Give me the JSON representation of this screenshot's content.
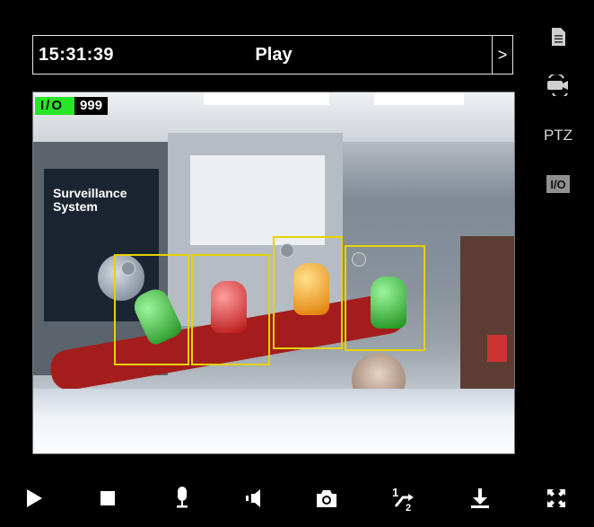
{
  "topbar": {
    "time": "15:31:39",
    "mode": "Play",
    "next_glyph": ">"
  },
  "overlay": {
    "io_label": "I/O",
    "io_count": "999"
  },
  "poster": {
    "title_line1": "Surveillance",
    "title_line2": "System"
  },
  "side_panel": {
    "ptz_label": "PTZ",
    "io_button_label": "I/O"
  },
  "icons": {
    "document": "document-icon",
    "camera_switch": "camera-switch-icon",
    "play": "play-icon",
    "stop": "stop-icon",
    "microphone": "microphone-icon",
    "speaker": "speaker-icon",
    "snapshot": "snapshot-camera-icon",
    "speed": "half-speed-icon",
    "download": "download-icon",
    "fullscreen": "fullscreen-icon"
  },
  "bottom": {
    "speed_fraction": "½"
  },
  "colors": {
    "io_active": "#27e627",
    "detection_box": "#e6d200"
  }
}
